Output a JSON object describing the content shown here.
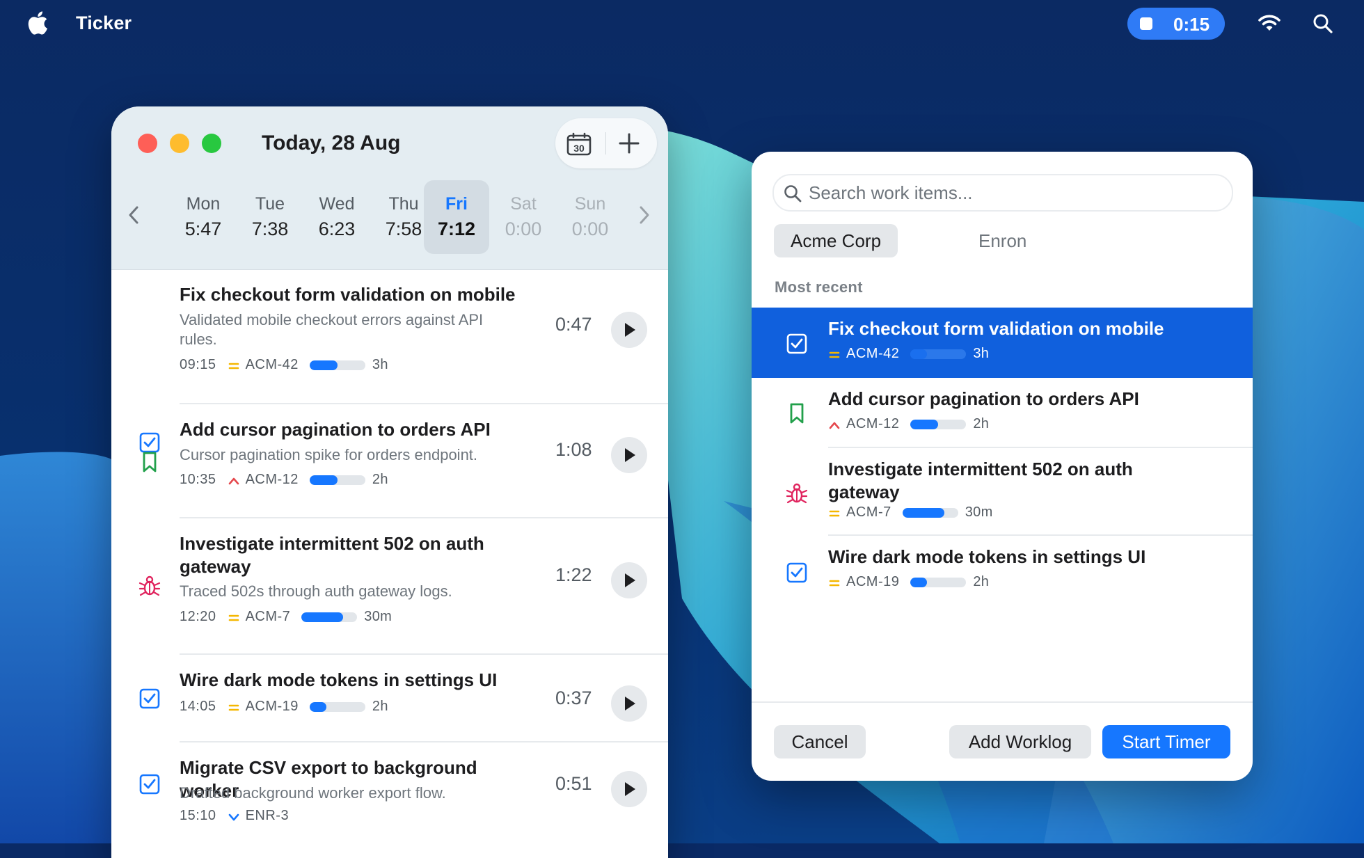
{
  "menubar": {
    "app_name": "Ticker",
    "running_timer": "0:15"
  },
  "day_window": {
    "title": "Today, 28 Aug",
    "week": [
      {
        "day": "Mon",
        "total": "5:47",
        "state": "past"
      },
      {
        "day": "Tue",
        "total": "7:38",
        "state": "past"
      },
      {
        "day": "Wed",
        "total": "6:23",
        "state": "past"
      },
      {
        "day": "Thu",
        "total": "7:58",
        "state": "past"
      },
      {
        "day": "Fri",
        "total": "7:12",
        "state": "selected"
      },
      {
        "day": "Sat",
        "total": "0:00",
        "state": "future"
      },
      {
        "day": "Sun",
        "total": "0:00",
        "state": "future"
      }
    ],
    "entries": [
      {
        "type_icon": "task-checkbox-icon",
        "title": "Fix checkout form validation on mobile",
        "description": "Validated mobile checkout errors against API rules.",
        "start": "09:15",
        "priority_icon": "medium-priority-icon",
        "key": "ACM-42",
        "progress": 0.5,
        "estimate": "3h",
        "duration": "0:47"
      },
      {
        "type_icon": "story-bookmark-icon",
        "title": "Add cursor pagination to orders API",
        "description": "Cursor pagination spike for orders endpoint.",
        "start": "10:35",
        "priority_icon": "high-priority-icon",
        "key": "ACM-12",
        "progress": 0.5,
        "estimate": "2h",
        "duration": "1:08"
      },
      {
        "type_icon": "bug-icon",
        "title": "Investigate intermittent 502 on auth gateway",
        "description": "Traced 502s through auth gateway logs.",
        "start": "12:20",
        "priority_icon": "medium-priority-icon",
        "key": "ACM-7",
        "progress": 0.75,
        "estimate": "30m",
        "duration": "1:22"
      },
      {
        "type_icon": "task-checkbox-icon",
        "title": "Wire dark mode tokens in settings UI",
        "description": "",
        "start": "14:05",
        "priority_icon": "medium-priority-icon",
        "key": "ACM-19",
        "progress": 0.3,
        "estimate": "2h",
        "duration": "0:37"
      },
      {
        "type_icon": "task-checkbox-icon",
        "title": "Migrate CSV export to background worker",
        "description": "Drafted background worker export flow.",
        "start": "15:10",
        "priority_icon": "low-priority-icon",
        "key": "ENR-3",
        "progress": null,
        "estimate": "",
        "duration": "0:51"
      }
    ]
  },
  "picker": {
    "search_placeholder": "Search work items...",
    "customers": [
      "Acme Corp",
      "Enron"
    ],
    "active_customer": "Acme Corp",
    "section_label": "Most recent",
    "items": [
      {
        "type_icon": "task-checkbox-icon",
        "title": "Fix checkout form validation on mobile",
        "priority_icon": "medium-priority-icon",
        "key": "ACM-42",
        "progress": 0.3,
        "estimate": "3h",
        "selected": true
      },
      {
        "type_icon": "story-bookmark-icon",
        "title": "Add cursor pagination to orders API",
        "priority_icon": "high-priority-icon",
        "key": "ACM-12",
        "progress": 0.5,
        "estimate": "2h",
        "selected": false
      },
      {
        "type_icon": "bug-icon",
        "title": "Investigate intermittent 502 on auth gateway",
        "priority_icon": "medium-priority-icon",
        "key": "ACM-7",
        "progress": 0.75,
        "estimate": "30m",
        "selected": false
      },
      {
        "type_icon": "task-checkbox-icon",
        "title": "Wire dark mode tokens in settings UI",
        "priority_icon": "medium-priority-icon",
        "key": "ACM-19",
        "progress": 0.3,
        "estimate": "2h",
        "selected": false
      }
    ],
    "buttons": {
      "cancel": "Cancel",
      "add_worklog": "Add Worklog",
      "start_timer": "Start Timer"
    }
  },
  "colors": {
    "accent": "#1677ff",
    "selected_row": "#1060dd",
    "task_icon": "#1677ff",
    "story_icon": "#22a04b",
    "bug_icon": "#e0245e",
    "priority_medium": "#f5b700",
    "priority_high": "#e5484d",
    "priority_low": "#1677ff"
  }
}
